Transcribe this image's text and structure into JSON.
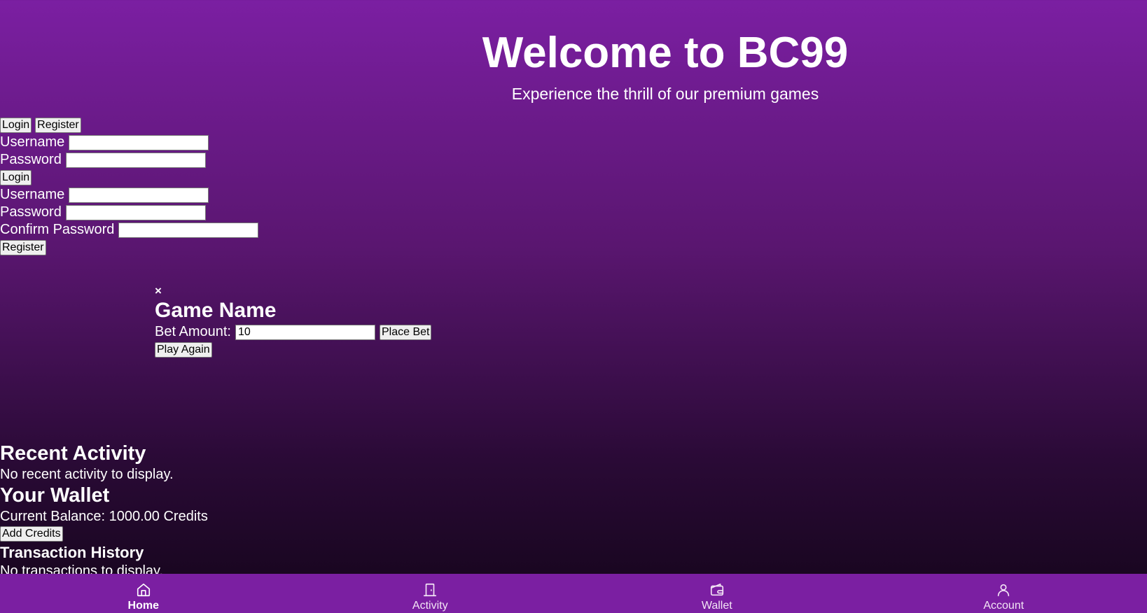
{
  "hero": {
    "title": "Welcome to BC99",
    "subtitle": "Experience the thrill of our premium games"
  },
  "auth": {
    "tabs": {
      "login": "Login",
      "register": "Register"
    },
    "login_form": {
      "username_label": "Username",
      "password_label": "Password",
      "submit": "Login"
    },
    "register_form": {
      "username_label": "Username",
      "password_label": "Password",
      "confirm_label": "Confirm Password",
      "submit": "Register"
    }
  },
  "game_modal": {
    "close": "×",
    "title": "Game Name",
    "bet_label": "Bet Amount:",
    "bet_value": "10",
    "place_bet": "Place Bet",
    "play_again": "Play Again"
  },
  "activity": {
    "heading": "Recent Activity",
    "empty": "No recent activity to display."
  },
  "wallet": {
    "heading": "Your Wallet",
    "balance": "Current Balance: 1000.00 Credits",
    "add_credits": "Add Credits",
    "history_heading": "Transaction History",
    "history_empty": "No transactions to display."
  },
  "nav": {
    "items": [
      {
        "label": "Home",
        "icon": "home-icon",
        "active": true
      },
      {
        "label": "Activity",
        "icon": "activity-icon",
        "active": false
      },
      {
        "label": "Wallet",
        "icon": "wallet-icon",
        "active": false
      },
      {
        "label": "Account",
        "icon": "account-icon",
        "active": false
      }
    ]
  },
  "colors": {
    "nav_background": "#7b1fa2",
    "gradient_top": "#7b1fa2",
    "gradient_bottom": "#14051a"
  }
}
